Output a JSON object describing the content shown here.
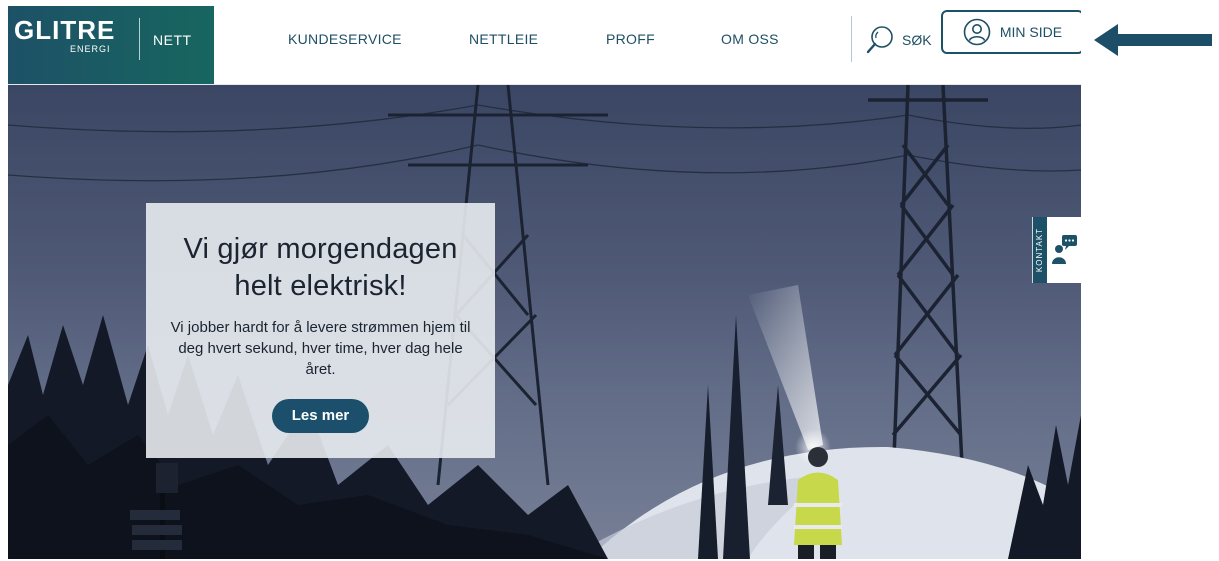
{
  "brand": {
    "name": "GLITRE",
    "sub": "ENERGI",
    "section": "NETT"
  },
  "nav": {
    "items": [
      {
        "label": "KUNDESERVICE"
      },
      {
        "label": "NETTLEIE"
      },
      {
        "label": "PROFF"
      },
      {
        "label": "OM OSS"
      }
    ],
    "search_label": "SØK",
    "min_side_label": "MIN SIDE"
  },
  "hero": {
    "title": "Vi gjør morgendagen helt elektrisk!",
    "text": "Vi jobber hardt for å levere strømmen hjem til deg hvert sekund, hver time, hver dag hele året.",
    "button_label": "Les mer"
  },
  "kontakt": {
    "label": "KONTAKT"
  },
  "colors": {
    "brand_dark": "#1d5167",
    "brand_teal": "#17665f",
    "nav_text": "#1f4f64",
    "button": "#1b4f6c",
    "annotation_arrow": "#1d4e68"
  },
  "icons": {
    "search": "search-icon",
    "user": "user-circle-icon",
    "kontakt": "chat-person-icon",
    "annotation": "arrow-left-icon"
  }
}
